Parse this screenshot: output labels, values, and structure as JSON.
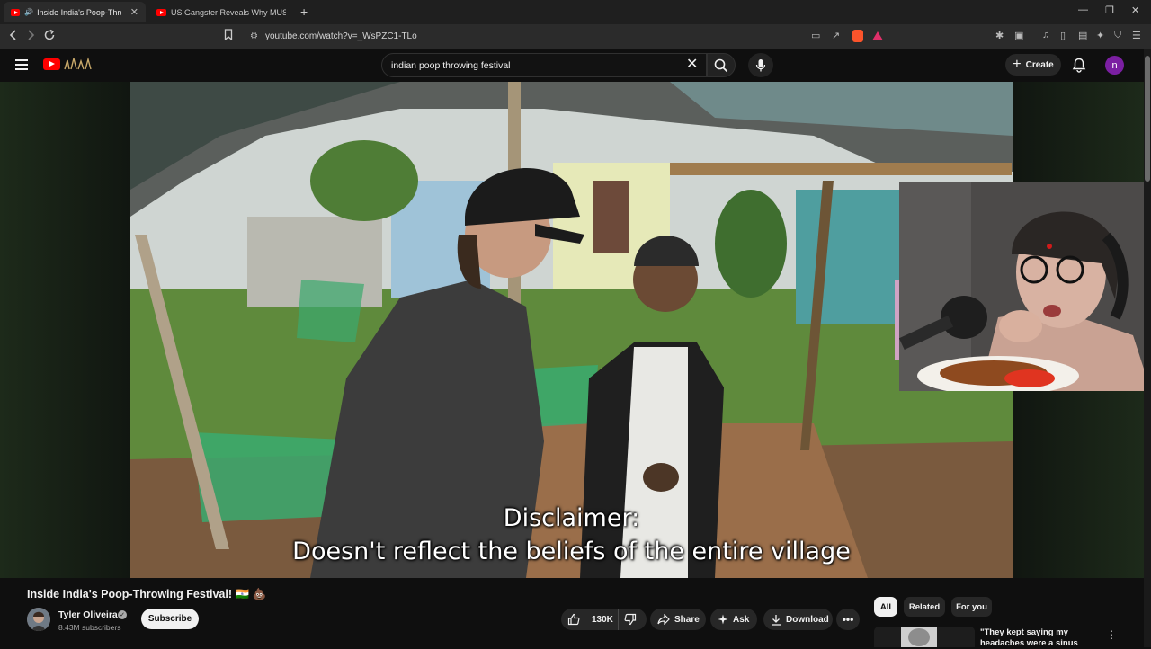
{
  "browser": {
    "tabs": [
      {
        "label": "Inside India's Poop-Throwing",
        "active": true
      },
      {
        "label": "US Gangster Reveals Why MUSLIMS",
        "active": false
      }
    ],
    "url": "youtube.com/watch?v=_WsPZC1-TLo"
  },
  "header": {
    "search_value": "indian poop throwing festival",
    "create_label": "Create",
    "avatar_letter": "n"
  },
  "video": {
    "subtitle_line1": "Disclaimer:",
    "subtitle_line2": "Doesn't reflect the beliefs of the entire village"
  },
  "details": {
    "title": "Inside India's Poop-Throwing Festival! 🇮🇳 💩",
    "channel_name": "Tyler Oliveira",
    "subscribers": "8.43M subscribers",
    "subscribe_label": "Subscribe",
    "likes": "130K",
    "share_label": "Share",
    "ask_label": "Ask",
    "download_label": "Download"
  },
  "sidebar": {
    "chips": [
      "All",
      "Related",
      "For you"
    ],
    "rec_title": "\"They kept saying my headaches were a sinus"
  },
  "colors": {
    "brand_red": "#ff0000",
    "avatar_purple": "#7b1fa2",
    "background": "#0f0f0f"
  }
}
